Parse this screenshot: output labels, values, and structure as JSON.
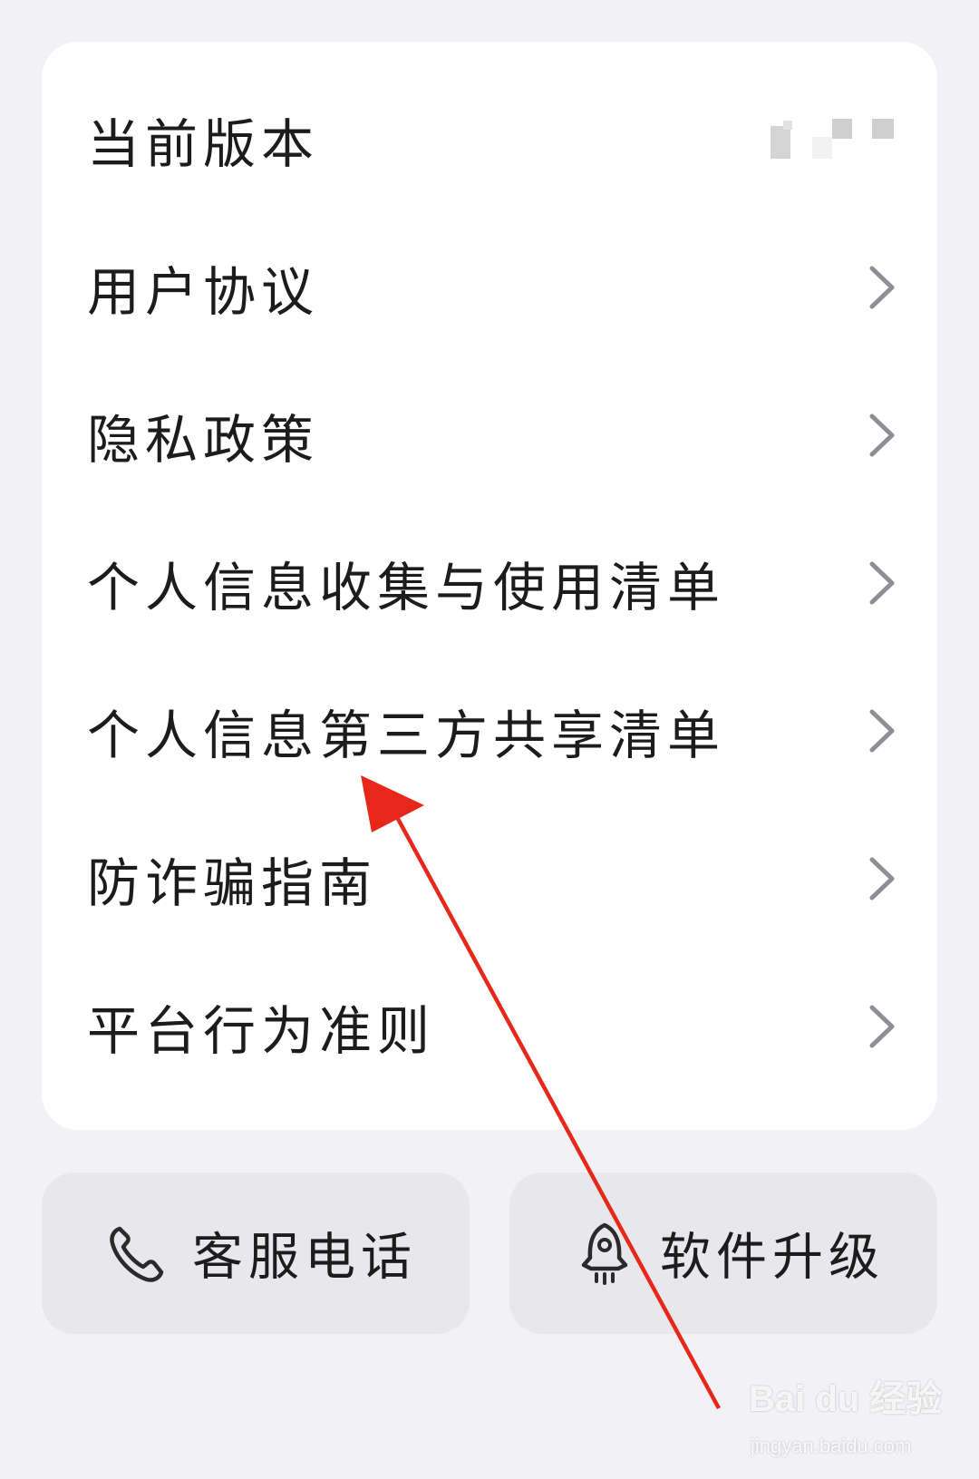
{
  "menu": {
    "items": [
      {
        "label": "当前版本",
        "has_chevron": false
      },
      {
        "label": "用户协议",
        "has_chevron": true
      },
      {
        "label": "隐私政策",
        "has_chevron": true
      },
      {
        "label": "个人信息收集与使用清单",
        "has_chevron": true
      },
      {
        "label": "个人信息第三方共享清单",
        "has_chevron": true
      },
      {
        "label": "防诈骗指南",
        "has_chevron": true
      },
      {
        "label": "平台行为准则",
        "has_chevron": true
      }
    ]
  },
  "buttons": {
    "customer_service": {
      "label": "客服电话",
      "icon": "phone-icon"
    },
    "software_upgrade": {
      "label": "软件升级",
      "icon": "rocket-icon"
    }
  },
  "annotation": {
    "color": "#e8271b"
  },
  "watermark": {
    "brand": "Bai du 经验",
    "url": "jingyan.baidu.com"
  },
  "colors": {
    "background": "#f2f2f6",
    "card": "#ffffff",
    "button": "#e8e8ec",
    "chevron": "#8e8e96"
  }
}
